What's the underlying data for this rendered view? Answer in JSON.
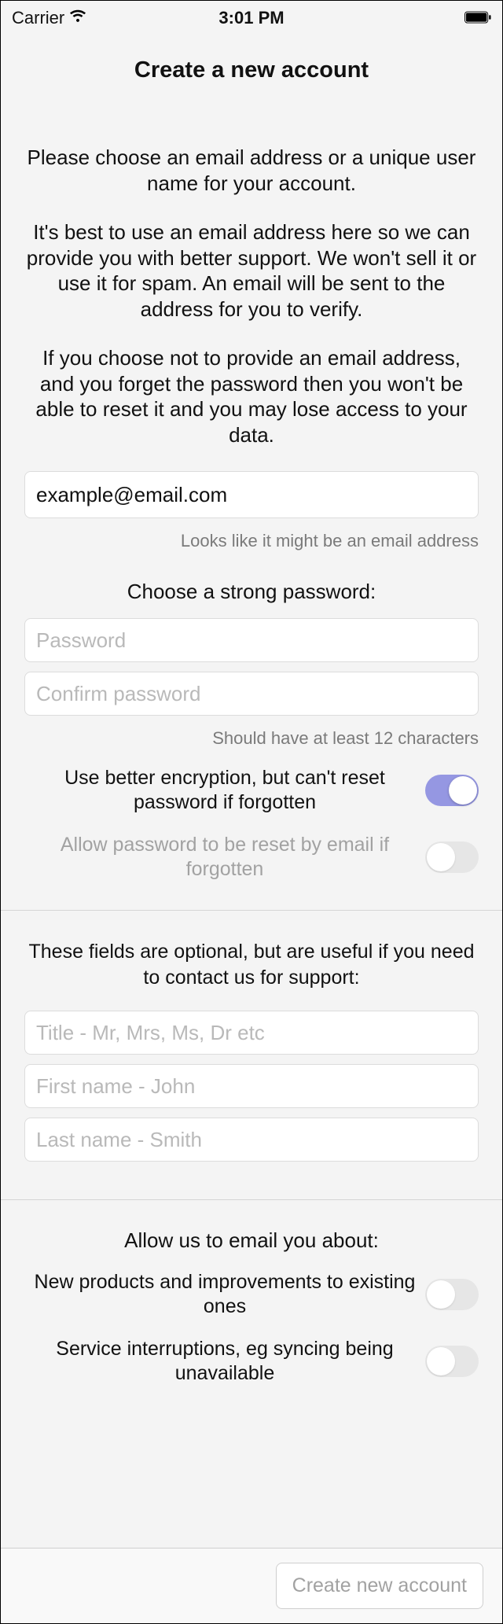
{
  "status_bar": {
    "carrier": "Carrier",
    "time": "3:01 PM"
  },
  "title": "Create a new account",
  "intro": {
    "p1": "Please choose an email address or a unique user name for your account.",
    "p2": "It's best to use an email address here so we can provide you with better support. We won't sell it or use it for spam. An email will be sent to the address for you to verify.",
    "p3": "If you choose not to provide an email address, and you forget the password then you won't be able to reset it and you may lose access to your data."
  },
  "email": {
    "value": "example@email.com",
    "hint": "Looks like it might be an email address"
  },
  "password": {
    "heading": "Choose a strong password:",
    "placeholder": "Password",
    "confirm_placeholder": "Confirm password",
    "hint": "Should have at least 12 characters"
  },
  "toggles_top": {
    "better_encryption_label": "Use better encryption, but can't reset password if forgotten",
    "better_encryption_on": true,
    "allow_reset_label": "Allow password to be reset by email if forgotten",
    "allow_reset_on": false
  },
  "optional": {
    "intro": "These fields are optional, but are useful if you need to contact us for support:",
    "title_placeholder": "Title - Mr, Mrs, Ms, Dr etc",
    "first_placeholder": "First name - John",
    "last_placeholder": "Last name - Smith"
  },
  "email_prefs": {
    "heading": "Allow us to email you about:",
    "new_products_label": "New products and improvements to existing ones",
    "new_products_on": false,
    "service_label": "Service interruptions, eg syncing being unavailable",
    "service_on": false
  },
  "bottom": {
    "create_label": "Create new account"
  }
}
